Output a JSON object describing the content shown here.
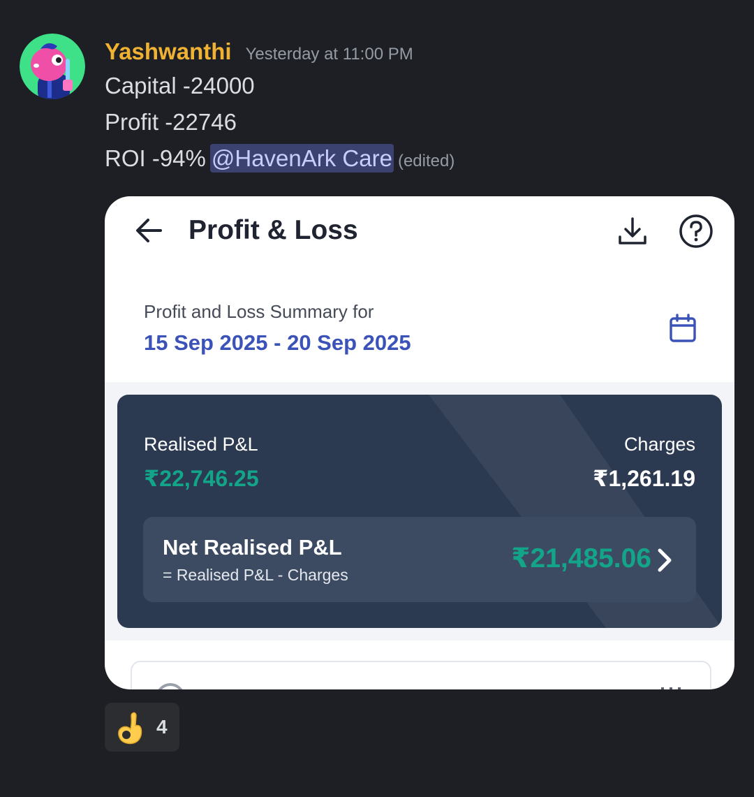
{
  "message": {
    "username": "Yashwanthi",
    "timestamp": "Yesterday at 11:00 PM",
    "lines": [
      "Capital -24000",
      "Profit -22746",
      "ROI -94%"
    ],
    "mention": "@HavenArk Care",
    "edited_label": "(edited)",
    "avatar_icon": "avatar-character-icon",
    "colors": {
      "username": "#f0b232",
      "mention_bg": "#3c4270"
    }
  },
  "attachment": {
    "header": {
      "title": "Profit & Loss",
      "back_icon": "arrow-left-icon",
      "download_icon": "download-icon",
      "help_icon": "help-circle-icon"
    },
    "summary": {
      "label": "Profit and Loss Summary for",
      "date_range": "15 Sep 2025 - 20 Sep 2025",
      "calendar_icon": "calendar-icon"
    },
    "card": {
      "realised_label": "Realised P&L",
      "realised_value": "₹22,746.25",
      "charges_label": "Charges",
      "charges_value": "₹1,261.19",
      "net_title": "Net Realised P&L",
      "net_formula": "= Realised P&L - Charges",
      "net_value": "₹21,485.06",
      "chevron_icon": "chevron-right-icon",
      "colors": {
        "card_bg": "#2c3a51",
        "positive": "#13a58a"
      }
    }
  },
  "reaction": {
    "emoji": "ok-hand-icon",
    "count": "4"
  }
}
